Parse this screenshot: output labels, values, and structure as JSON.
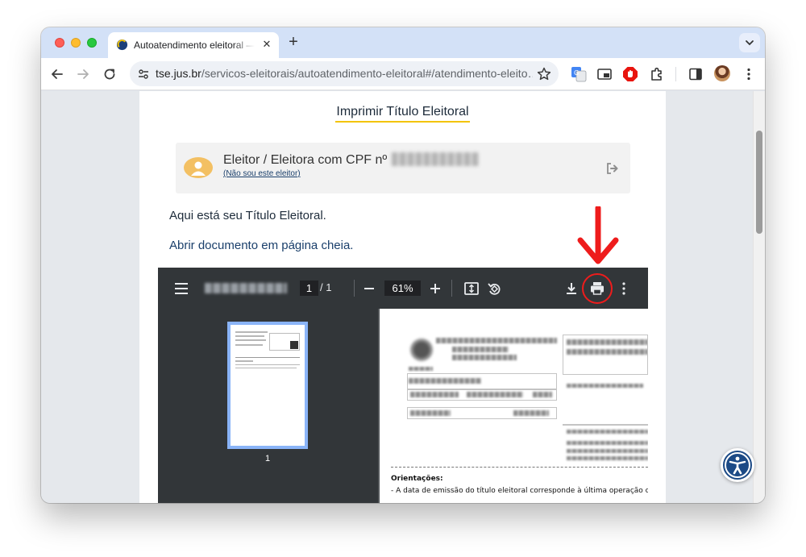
{
  "browser": {
    "tab_title": "Autoatendimento eleitoral — Tribunal Superior Eleitoral",
    "tab_close": "✕",
    "new_tab": "+",
    "url_domain": "tse.jus.br",
    "url_path": "/servicos-eleitorais/autoatendimento-eleitoral#/atendimento-eleito…"
  },
  "page": {
    "heading": "Imprimir Título Eleitoral",
    "voter_label": "Eleitor / Eleitora com CPF nº",
    "not_me_link": "(Não sou este eleitor)",
    "message": "Aqui está seu Título Eleitoral.",
    "open_full_link": "Abrir documento em página cheia."
  },
  "pdf_viewer": {
    "current_page": "1",
    "total_pages": "/  1",
    "zoom": "61%",
    "thumbnail_page_number": "1",
    "orientation_title": "Orientações:",
    "orientation_text": "- A data de emissão do título eleitoral corresponde à última operação cadastral"
  },
  "colors": {
    "highlight": "#ee1c1c",
    "accent_underline": "#f3c400",
    "link": "#1a3f6b",
    "accessibility_button": "#1c4a86"
  }
}
